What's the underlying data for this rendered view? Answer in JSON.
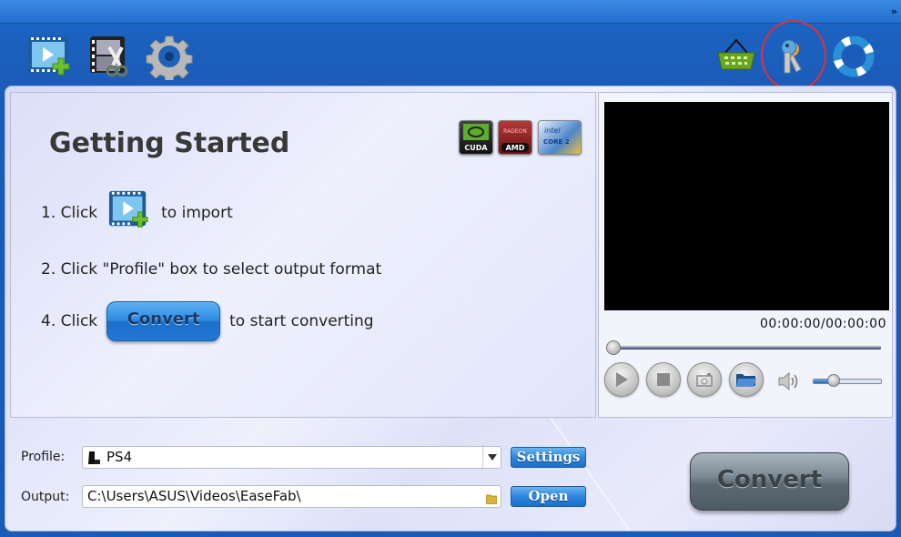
{
  "titlebar": {
    "more_label": "»"
  },
  "toolbar": {
    "left": [
      {
        "name": "add-video-icon",
        "tooltip": "Add Video"
      },
      {
        "name": "edit-video-icon",
        "tooltip": "Edit"
      },
      {
        "name": "settings-gear-icon",
        "tooltip": "Options"
      }
    ],
    "right": [
      {
        "name": "basket-icon",
        "tooltip": "Buy"
      },
      {
        "name": "keys-icon",
        "tooltip": "Register",
        "highlighted": true
      },
      {
        "name": "lifebuoy-icon",
        "tooltip": "Help"
      }
    ],
    "highlight_color": "#e0303a"
  },
  "guide": {
    "title": "Getting Started",
    "badges": [
      "CUDA",
      "AMD",
      "CORE 2"
    ],
    "steps": [
      {
        "prefix": "1. Click",
        "suffix": "to import"
      },
      {
        "text": "2. Click \"Profile\" box to select output format"
      },
      {
        "prefix": "4. Click",
        "button": "Convert",
        "suffix": "to start converting"
      }
    ]
  },
  "preview": {
    "time": "00:00:00/00:00:00",
    "seek_progress": 0,
    "volume_level": 0.3
  },
  "bottom": {
    "profile_label": "Profile:",
    "profile_value": "PS4",
    "output_label": "Output:",
    "output_value": "C:\\Users\\ASUS\\Videos\\EaseFab\\",
    "settings_label": "Settings",
    "open_label": "Open",
    "convert_label": "Convert"
  }
}
